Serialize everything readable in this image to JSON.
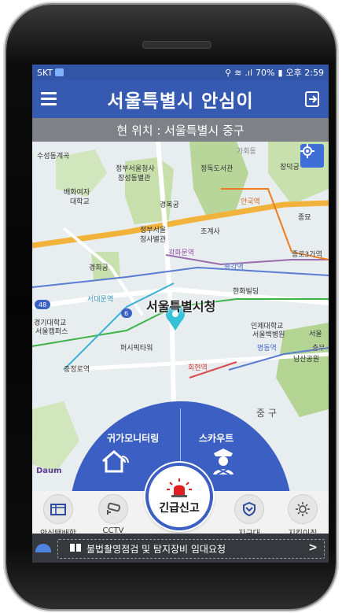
{
  "status": {
    "carrier": "SKT",
    "battery_percent": "70%",
    "time": "오후 2:59"
  },
  "header": {
    "title": "서울특별시 안심이",
    "menu_icon": "hamburger-menu-icon",
    "exit_icon": "exit-icon"
  },
  "location": {
    "text": "현 위치 : 서울특별시 중구"
  },
  "map": {
    "labels": {
      "a1": "수성동계곡",
      "a2": "정부서울청사",
      "a3": "창성동별관",
      "a4": "정독도서관",
      "a5": "창덕궁",
      "a6": "배화여자",
      "a7": "대학교",
      "a8": "경복궁",
      "a9": "안국역",
      "a10": "종묘",
      "a11": "정부서울",
      "a12": "청사별관",
      "a13": "조계사",
      "a14": "광화문역",
      "a15": "종로3가역",
      "a16": "경희궁",
      "a17": "종각역",
      "a18": "한화빌딩",
      "a19": "서대문역",
      "a20": "서울특별시청",
      "a21": "경기대학교",
      "a22": "서울캠퍼스",
      "a23": "인제대학교",
      "a24": "서울백병원",
      "a25": "퍼시픽타워",
      "a26": "명동역",
      "a27": "충무",
      "a28": "충정로역",
      "a29": "회현역",
      "a30": "남산공원",
      "a31": "중 구",
      "a32": "서울",
      "a33": "가회동",
      "a34": "48",
      "a35": "6"
    },
    "gps_icon": "gps-locate-icon",
    "provider": "Daum"
  },
  "quick_actions": [
    {
      "label": "귀가모니터링",
      "icon": "home-wifi-icon"
    },
    {
      "label": "스카우트",
      "icon": "scout-officer-icon"
    }
  ],
  "dock": [
    {
      "label": "안심택배함",
      "icon": "parcel-box-icon"
    },
    {
      "label": "CCTV",
      "icon": "cctv-camera-icon"
    },
    {
      "label": "지구대",
      "icon": "police-badge-icon"
    },
    {
      "label": "지킴이집",
      "icon": "guardian-house-icon"
    }
  ],
  "emergency": {
    "label": "긴급신고",
    "icon": "siren-icon"
  },
  "banner": {
    "text": "불법촬영점검 및 탐지장비 임대요청",
    "chevron": ">"
  },
  "colors": {
    "primary": "#3659b1",
    "quick_panel": "#3c5fc3",
    "location_bar": "#7e8187",
    "banner_bg": "#35383d",
    "siren": "#e02020"
  }
}
